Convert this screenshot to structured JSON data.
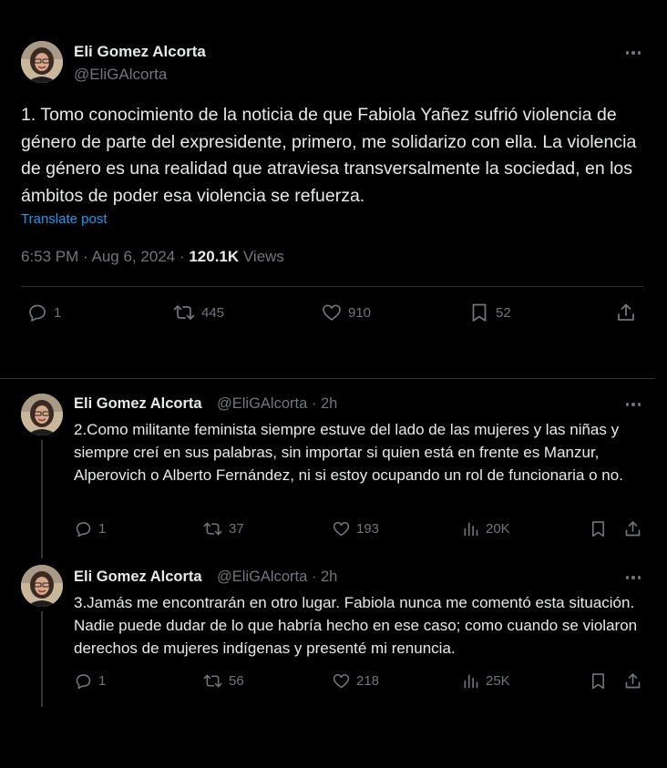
{
  "main": {
    "author_name": "Eli Gomez Alcorta",
    "author_handle": "@EliGAlcorta",
    "text": "1. Tomo conocimiento de la noticia de que Fabiola Yañez sufrió violencia de género de parte del expresidente, primero, me solidarizo con ella. La violencia de género es una realidad que atraviesa transversalmente la sociedad, en los ámbitos de poder esa violencia se refuerza.",
    "translate_label": "Translate post",
    "time": "6:53 PM",
    "date": "Aug 6, 2024",
    "views_count": "120.1K",
    "views_label": "Views",
    "replies": "1",
    "reposts": "445",
    "likes": "910",
    "bookmarks": "52"
  },
  "replies": [
    {
      "author_name": "Eli Gomez Alcorta",
      "author_handle": "@EliGAlcorta",
      "time": "· 2h",
      "text": "2.Como militante feminista siempre estuve del lado de las mujeres y las niñas y siempre creí en sus palabras, sin importar si quien está en frente es Manzur, Alperovich o Alberto Fernández, ni si estoy ocupando un rol de funcionaria o no.",
      "replies": "1",
      "reposts": "37",
      "likes": "193",
      "views": "20K"
    },
    {
      "author_name": "Eli Gomez Alcorta",
      "author_handle": "@EliGAlcorta",
      "time": "· 2h",
      "text": "3.Jamás me encontrarán en otro lugar. Fabiola nunca me comentó esta situación. Nadie puede dudar de lo que habría hecho en ese caso; como cuando se violaron derechos de mujeres indígenas y presenté mi renuncia.",
      "replies": "1",
      "reposts": "56",
      "likes": "218",
      "views": "25K"
    }
  ],
  "colors": {
    "background": "#000000",
    "text": "#e7e9ea",
    "muted": "#71767b",
    "link": "#1d9bf0",
    "divider": "#2f3336"
  }
}
